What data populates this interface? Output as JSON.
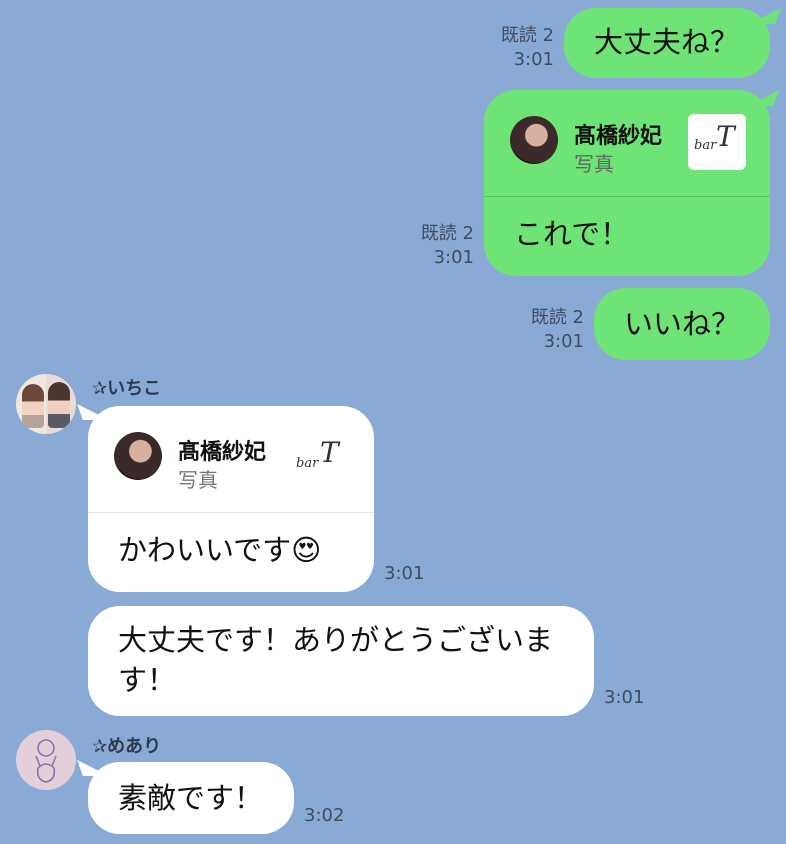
{
  "messages_out": [
    {
      "read": "既読 2",
      "time": "3:01",
      "text": "大丈夫ね？"
    },
    {
      "read": "既読 2",
      "time": "3:01",
      "card_name": "髙橋紗妃",
      "card_sub": "写真",
      "text": "これで！"
    },
    {
      "read": "既読 2",
      "time": "3:01",
      "text": "いいね？"
    }
  ],
  "messages_in": [
    {
      "sender": "✰いちこ",
      "card_name": "髙橋紗妃",
      "card_sub": "写真",
      "text": "かわいいです",
      "emoji": "😍",
      "time": "3:01"
    },
    {
      "text_line1": "大丈夫です！ありがとうございま",
      "text_line2": "す！",
      "time": "3:01"
    },
    {
      "sender": "✰めあり",
      "text": "素敵です！",
      "time": "3:02"
    }
  ],
  "logo_text": "bar",
  "colors": {
    "background": "#8aaad6",
    "outgoing": "#6ee476",
    "incoming": "#ffffff"
  }
}
